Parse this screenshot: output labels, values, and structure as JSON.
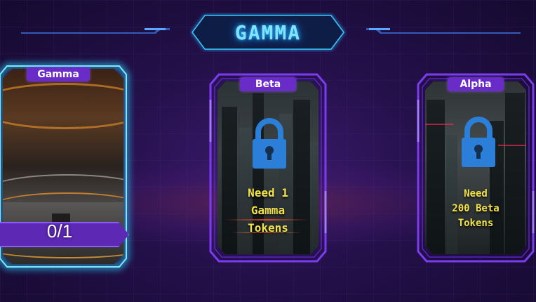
{
  "header": {
    "title": "GAMMA"
  },
  "cards": {
    "gamma": {
      "label": "Gamma",
      "counter": "0/1",
      "locked": false
    },
    "beta": {
      "label": "Beta",
      "locked": true,
      "requirement_lines": [
        "Need 1",
        "Gamma",
        "Tokens"
      ]
    },
    "alpha": {
      "label": "Alpha",
      "locked": true,
      "requirement_lines": [
        "Need",
        "200 Beta",
        "Tokens"
      ]
    }
  },
  "colors": {
    "accent_purple": "#7b3cf0",
    "selected_glow": "#2ad4ff",
    "lock_blue": "#2b7fd8",
    "requirement_yellow": "#f2e24a",
    "title_cyan": "#7fe4ff"
  },
  "icons": {
    "lock": "padlock-icon"
  }
}
